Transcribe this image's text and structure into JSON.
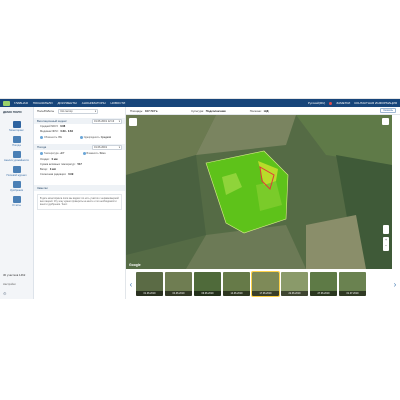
{
  "topbar": {
    "nav": [
      "ГЛАВНАЯ",
      "ПОКАЗАТЕЛИ",
      "ДОКУМЕНТЫ",
      "АНОНИМАТОРЫ",
      "НОВОСТИ"
    ],
    "right_items": [
      "Русский(RU)",
      "ЗАМЕТКИ",
      "КОНТАКТНАЯ ИНФОРМАЦИЯ"
    ]
  },
  "sidebar": {
    "title": "ДЕМО ПОЛЯ",
    "items": [
      {
        "label": "Мониторинг",
        "icon": "map-icon"
      },
      {
        "label": "Погода",
        "icon": "cloud-icon"
      },
      {
        "label": "Анализ урожайности",
        "icon": "chart-icon"
      },
      {
        "label": "Полевой журнал",
        "icon": "journal-icon"
      },
      {
        "label": "Удобрения",
        "icon": "fertilizer-icon"
      },
      {
        "label": "Отчёты",
        "icon": "report-icon"
      }
    ],
    "footer": "30 участков 1462",
    "footer2": "Настройки"
  },
  "panel": {
    "field_label": "Поле/Работы",
    "field_value": "СН сектор",
    "sec1": {
      "title": "Вегетационный индекс",
      "date": "01.06.2019 12:13"
    },
    "kv1": [
      {
        "k": "Средний NDVI:",
        "v": "0.68"
      },
      {
        "k": "Медиана NDVI:",
        "v": "0.69 - 0.84"
      }
    ],
    "mini1": [
      {
        "k": "Облачность",
        "v": "0%"
      },
      {
        "k": "Однородность",
        "v": "Средняя"
      }
    ],
    "sec2": {
      "title": "Погода",
      "date": "01.06.2019"
    },
    "mini2": [
      {
        "k": "Температура",
        "v": "+23°"
      },
      {
        "k": "Влажность",
        "v": "Ясно"
      }
    ],
    "kv2": [
      {
        "k": "Осадки:",
        "v": "0 мм"
      },
      {
        "k": "Сумма активных температур:",
        "v": "517"
      },
      {
        "k": "Ветер:",
        "v": "3 м/с"
      },
      {
        "k": "Солнечная радиация:",
        "v": "0.09"
      }
    ],
    "note_title": "Заметки",
    "note_text": "В дате мониторинга поля мы видим что есть участок с неравномерной вегетацией. Эту зону нужно проверить на месте и по необходимости внести удобрения. Текст."
  },
  "mapheader": {
    "area_label": "Площадь:",
    "area_value": "107.79 Га",
    "crop_label": "Культура:",
    "crop_value": "Подсолнечник",
    "sowing_label": "Посеяно:",
    "sowing_value": "Н/Д",
    "button": "Скачать"
  },
  "map": {
    "google": "Google"
  },
  "thumbs": [
    {
      "date": "01.06.2019"
    },
    {
      "date": "04.06.2019"
    },
    {
      "date": "09.06.2019"
    },
    {
      "date": "14.06.2019"
    },
    {
      "date": "17.06.2019"
    },
    {
      "date": "22.06.2019"
    },
    {
      "date": "27.06.2019"
    },
    {
      "date": "01.07.2019"
    }
  ],
  "colors": {
    "accent": "#2e63a0",
    "topbar": "#17457a",
    "ndvi_high": "#5ec21a",
    "ndvi_low": "#d9d320"
  }
}
